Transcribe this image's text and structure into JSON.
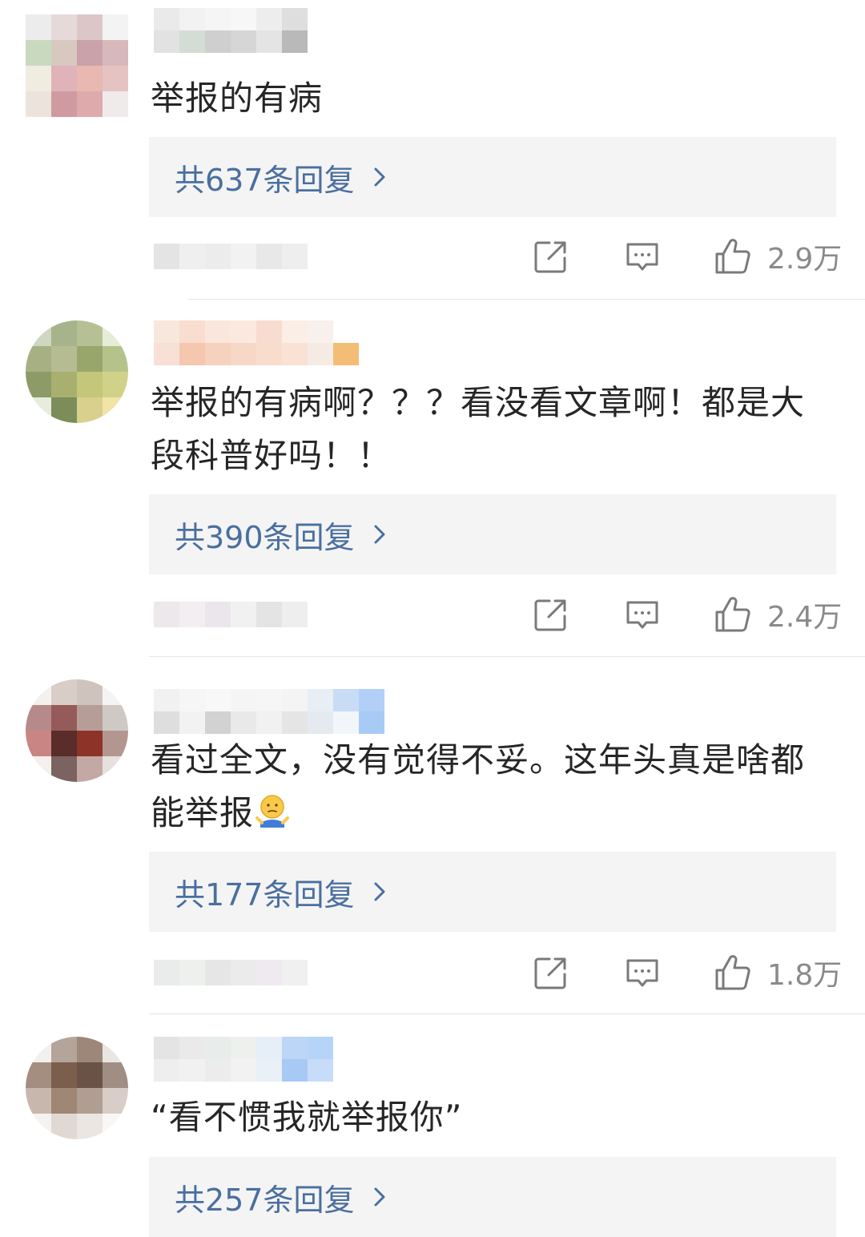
{
  "comments": [
    {
      "text": "举报的有病",
      "reply_label": "共637条回复",
      "like_count": "2.9万"
    },
    {
      "text": "举报的有病啊？？？看没看文章啊！都是大段科普好吗！！",
      "reply_label": "共390条回复",
      "like_count": "2.4万"
    },
    {
      "text": "看过全文，没有觉得不妥。这年头真是啥都能举报",
      "reply_label": "共177条回复",
      "like_count": "1.8万"
    },
    {
      "text": "“看不惯我就举报你”",
      "reply_label": "共257条回复"
    }
  ],
  "icons": {
    "share": "share-icon",
    "comment": "comment-icon",
    "like": "thumbs-up-icon",
    "reply_chevron": "chevron-right-icon",
    "emoji": "shrug-emoji-icon"
  },
  "colors": {
    "reply_link": "#4a6fa0",
    "reply_box_bg": "#f4f4f4",
    "text": "#262626",
    "muted": "#8a8a8a",
    "divider": "#e6e6e6"
  }
}
